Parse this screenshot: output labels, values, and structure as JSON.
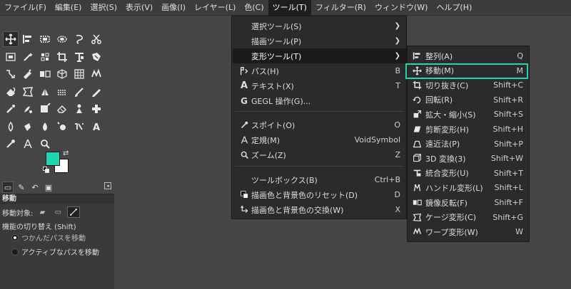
{
  "menubar": {
    "items": [
      "ファイル(F)",
      "編集(E)",
      "選択(S)",
      "表示(V)",
      "画像(I)",
      "レイヤー(L)",
      "色(C)",
      "ツール(T)",
      "フィルター(R)",
      "ウィンドウ(W)",
      "ヘルプ(H)"
    ],
    "active_index": 7
  },
  "toolbox": {
    "tools": [
      "move-icon",
      "align-icon",
      "rect-select-icon",
      "ellipse-select-icon",
      "free-select-icon",
      "scissors-icon",
      "fuzzy-select-icon",
      "magic-wand-icon",
      "color-select-icon",
      "crop-icon",
      "transform-icon",
      "foreground-select-icon",
      "paths-icon",
      "pen-icon",
      "flip-icon",
      "3d-cube-icon",
      "grid-icon",
      "warp-icon",
      "bucket-icon",
      "cage-icon",
      "paint-icon",
      "pattern-icon",
      "brush-icon",
      "pencil-icon",
      "airbrush-icon",
      "smudge-icon",
      "ink-icon",
      "eraser-icon",
      "clone-icon",
      "heal-icon",
      "blur-icon",
      "dodge-icon",
      "drop-icon",
      "sharpen-icon",
      "mypaint-icon",
      "text-icon",
      "eyedropper-icon",
      "measure-icon",
      "zoom-icon"
    ],
    "selected_tool": "move-icon",
    "foreground_color": "#1fd6b0",
    "background_color": "#ffffff"
  },
  "tool_options": {
    "title": "移動",
    "target_label": "移動対象:",
    "toggle_label": "機能の切り替え (Shift)",
    "radio_1": "つかんだパスを移動",
    "radio_2": "アクティブなパスを移動"
  },
  "tools_menu": {
    "items": [
      {
        "label": "選択ツール(S)",
        "shortcut": "",
        "submenu": true,
        "icon": ""
      },
      {
        "label": "描画ツール(P)",
        "shortcut": "",
        "submenu": true,
        "icon": ""
      },
      {
        "label": "変形ツール(T)",
        "shortcut": "",
        "submenu": true,
        "icon": "",
        "highlighted": true
      },
      {
        "label": "パス(H)",
        "shortcut": "B",
        "submenu": false,
        "icon": "paths-icon"
      },
      {
        "label": "テキスト(X)",
        "shortcut": "T",
        "submenu": false,
        "icon": "text-icon"
      },
      {
        "label": "GEGL 操作(G)...",
        "shortcut": "",
        "submenu": false,
        "icon": "gegl-icon"
      },
      {
        "label": "スポイト(O)",
        "shortcut": "O",
        "submenu": false,
        "icon": "eyedropper-icon"
      },
      {
        "label": "定規(M)",
        "shortcut": "VoidSymbol",
        "submenu": false,
        "icon": "measure-icon"
      },
      {
        "label": "ズーム(Z)",
        "shortcut": "Z",
        "submenu": false,
        "icon": "zoom-icon"
      },
      {
        "label": "ツールボックス(B)",
        "shortcut": "Ctrl+B",
        "submenu": false,
        "icon": ""
      },
      {
        "label": "描画色と背景色のリセット(D)",
        "shortcut": "D",
        "submenu": false,
        "icon": "reset-colors-icon"
      },
      {
        "label": "描画色と背景色の交換(W)",
        "shortcut": "X",
        "submenu": false,
        "icon": "swap-colors-icon"
      }
    ]
  },
  "transform_menu": {
    "items": [
      {
        "label": "整列(A)",
        "shortcut": "Q",
        "icon": "align-icon"
      },
      {
        "label": "移動(M)",
        "shortcut": "M",
        "icon": "move-icon",
        "highlighted": true
      },
      {
        "label": "切り抜き(C)",
        "shortcut": "Shift+C",
        "icon": "crop-icon"
      },
      {
        "label": "回転(R)",
        "shortcut": "Shift+R",
        "icon": "rotate-icon"
      },
      {
        "label": "拡大・縮小(S)",
        "shortcut": "Shift+S",
        "icon": "scale-icon"
      },
      {
        "label": "剪断変形(H)",
        "shortcut": "Shift+H",
        "icon": "shear-icon"
      },
      {
        "label": "遠近法(P)",
        "shortcut": "Shift+P",
        "icon": "perspective-icon"
      },
      {
        "label": "3D 変換(3)",
        "shortcut": "Shift+W",
        "icon": "3d-transform-icon"
      },
      {
        "label": "統合変形(U)",
        "shortcut": "Shift+T",
        "icon": "unified-transform-icon"
      },
      {
        "label": "ハンドル変形(L)",
        "shortcut": "Shift+L",
        "icon": "handle-transform-icon"
      },
      {
        "label": "鏡像反転(F)",
        "shortcut": "Shift+F",
        "icon": "flip-icon"
      },
      {
        "label": "ケージ変形(C)",
        "shortcut": "Shift+G",
        "icon": "cage-icon"
      },
      {
        "label": "ワープ変形(W)",
        "shortcut": "W",
        "icon": "warp-icon"
      }
    ],
    "highlight_color": "#1fd6b0"
  }
}
